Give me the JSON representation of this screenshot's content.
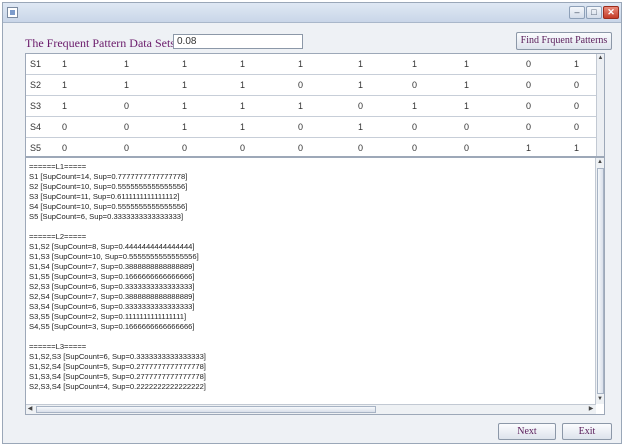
{
  "window": {
    "controls": {
      "minimize": "–",
      "maximize": "□",
      "close": "✕"
    }
  },
  "header": {
    "prompt_label": "The Frequent Pattern Data Sets Are:",
    "support_value": "0.08",
    "find_button": "Find Frquent Patterns"
  },
  "grid": {
    "rows": [
      {
        "label": "S1",
        "values": [
          "1",
          "1",
          "1",
          "1",
          "1",
          "1",
          "1",
          "1",
          "0",
          "1"
        ]
      },
      {
        "label": "S2",
        "values": [
          "1",
          "1",
          "1",
          "1",
          "0",
          "1",
          "0",
          "1",
          "0",
          "0"
        ]
      },
      {
        "label": "S3",
        "values": [
          "1",
          "0",
          "1",
          "1",
          "1",
          "0",
          "1",
          "1",
          "0",
          "0"
        ]
      },
      {
        "label": "S4",
        "values": [
          "0",
          "0",
          "1",
          "1",
          "0",
          "1",
          "0",
          "0",
          "0",
          "0"
        ]
      },
      {
        "label": "S5",
        "values": [
          "0",
          "0",
          "0",
          "0",
          "0",
          "0",
          "0",
          "0",
          "1",
          "1"
        ]
      }
    ]
  },
  "output": {
    "lines": [
      "======L1=====",
      "S1 [SupCount=14, Sup=0.7777777777777778]",
      "S2 [SupCount=10, Sup=0.5555555555555556]",
      "S3 [SupCount=11, Sup=0.6111111111111112]",
      "S4 [SupCount=10, Sup=0.5555555555555556]",
      "S5 [SupCount=6, Sup=0.3333333333333333]",
      "",
      "======L2=====",
      "S1,S2 [SupCount=8, Sup=0.4444444444444444]",
      "S1,S3 [SupCount=10, Sup=0.5555555555555556]",
      "S1,S4 [SupCount=7, Sup=0.3888888888888889]",
      "S1,S5 [SupCount=3, Sup=0.1666666666666666]",
      "S2,S3 [SupCount=6, Sup=0.3333333333333333]",
      "S2,S4 [SupCount=7, Sup=0.3888888888888889]",
      "S3,S4 [SupCount=6, Sup=0.3333333333333333]",
      "S3,S5 [SupCount=2, Sup=0.1111111111111111]",
      "S4,S5 [SupCount=3, Sup=0.1666666666666666]",
      "",
      "======L3=====",
      "S1,S2,S3 [SupCount=6, Sup=0.3333333333333333]",
      "S1,S2,S4 [SupCount=5, Sup=0.2777777777777778]",
      "S1,S3,S4 [SupCount=5, Sup=0.2777777777777778]",
      "S2,S3,S4 [SupCount=4, Sup=0.2222222222222222]"
    ]
  },
  "footer": {
    "next_button": "Next",
    "exit_button": "Exit"
  },
  "icons": {
    "app": "window-app-icon",
    "scroll_up": "▲",
    "scroll_down": "▼",
    "scroll_left": "◀",
    "scroll_right": "▶"
  }
}
